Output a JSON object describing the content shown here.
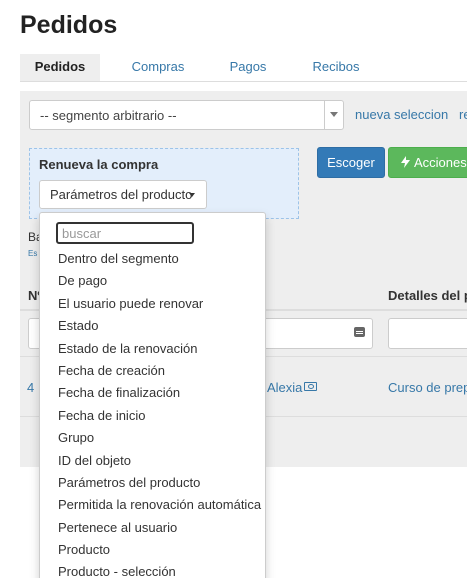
{
  "page": {
    "title": "Pedidos"
  },
  "tabs": [
    {
      "label": "Pedidos",
      "active": true
    },
    {
      "label": "Compras",
      "active": false
    },
    {
      "label": "Pagos",
      "active": false
    },
    {
      "label": "Recibos",
      "active": false
    }
  ],
  "segment": {
    "selected": "-- segmento arbitrario --",
    "new_selection_label": "nueva seleccion",
    "partial_link": "re"
  },
  "renew": {
    "title": "Renueva la compra",
    "params_button": "Parámetros del producto"
  },
  "actions": {
    "choose": "Escoger",
    "actions": "Acciones",
    "actions_icon": "bolt-icon"
  },
  "background": {
    "frag_text": "Ba",
    "frag_small": "Es"
  },
  "table": {
    "headers": {
      "number": "Nº",
      "details": "Detalles del p"
    },
    "row": {
      "id": "4",
      "user": "Alexia",
      "details": "Curso de prep"
    }
  },
  "dropdown": {
    "search_placeholder": "buscar",
    "items": [
      "Dentro del segmento",
      "De pago",
      "El usuario puede renovar",
      "Estado",
      "Estado de la renovación",
      "Fecha de creación",
      "Fecha de finalización",
      "Fecha de inicio",
      "Grupo",
      "ID del objeto",
      "Parámetros del producto",
      "Permitida la renovación automática",
      "Pertenece al usuario",
      "Producto",
      "Producto - selección"
    ]
  },
  "colors": {
    "link": "#3778a8",
    "primary": "#337ab7",
    "success": "#5cb85c",
    "panel": "#eeeeee",
    "highlight_box": "#e3eefb"
  }
}
